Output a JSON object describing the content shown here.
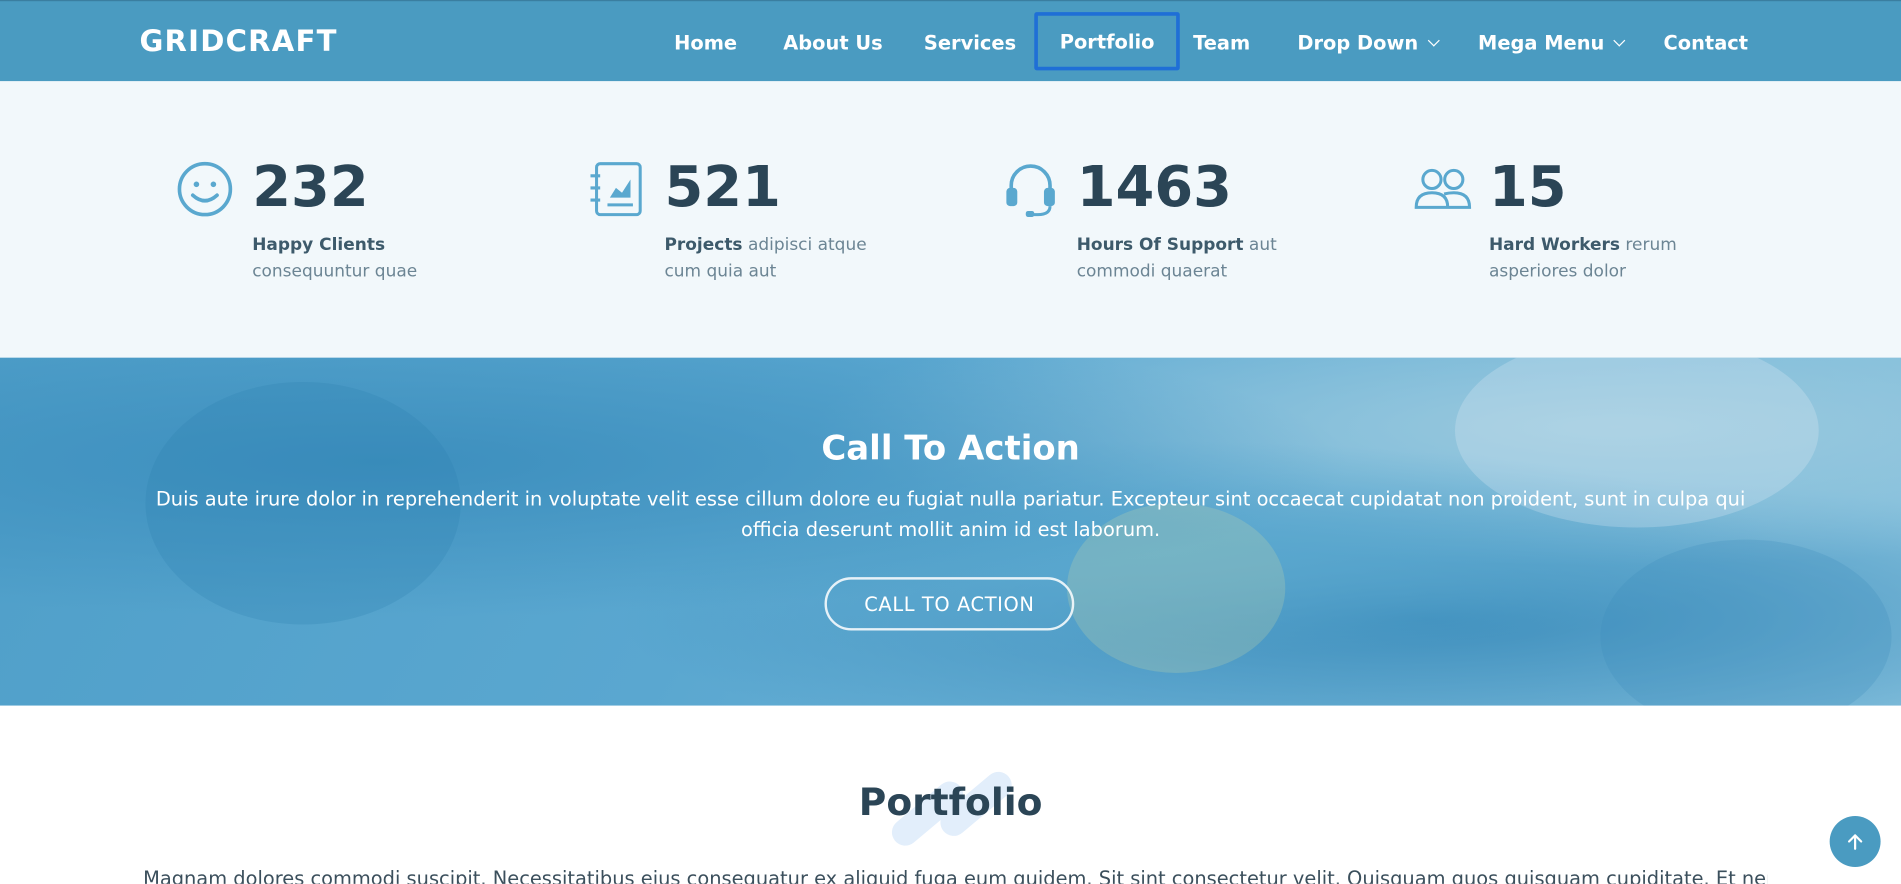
{
  "header": {
    "logo": "GRIDCRAFT",
    "nav": [
      {
        "label": "Home"
      },
      {
        "label": "About Us"
      },
      {
        "label": "Services"
      },
      {
        "label": "Portfolio"
      },
      {
        "label": "Team"
      },
      {
        "label": "Drop Down"
      },
      {
        "label": "Mega Menu"
      },
      {
        "label": "Contact"
      }
    ],
    "active_item": "Portfolio"
  },
  "stats": [
    {
      "icon": "smile-icon",
      "number": "232",
      "label": "Happy Clients",
      "text": "consequuntur quae"
    },
    {
      "icon": "journal-chart-icon",
      "number": "521",
      "label": "Projects",
      "text": "adipisci atque cum quia aut"
    },
    {
      "icon": "headset-icon",
      "number": "1463",
      "label": "Hours Of Support",
      "text": "aut commodi quaerat"
    },
    {
      "icon": "people-icon",
      "number": "15",
      "label": "Hard Workers",
      "text": "rerum asperiores dolor"
    }
  ],
  "cta": {
    "title": "Call To Action",
    "text": "Duis aute irure dolor in reprehenderit in voluptate velit esse cillum dolore eu fugiat nulla pariatur. Excepteur sint occaecat cupidatat non proident, sunt in culpa qui officia deserunt mollit anim id est laborum.",
    "button": "CALL TO ACTION"
  },
  "portfolio": {
    "title": "Portfolio",
    "text": "Magnam dolores commodi suscipit. Necessitatibus eius consequatur ex aliquid fuga eum quidem. Sit sint consectetur velit. Quisquam quos quisquam cupiditate. Et nemo qui"
  },
  "back_to_top": {
    "icon": "arrow-up-icon"
  },
  "colors": {
    "primary": "#4a9bc1",
    "heading": "#2b4556",
    "active_outline": "#1f6fd6"
  }
}
